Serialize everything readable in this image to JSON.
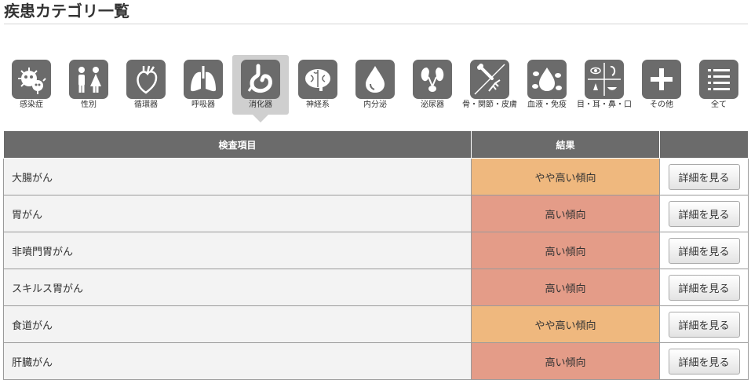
{
  "page": {
    "title": "疾患カテゴリ一覧"
  },
  "categories": [
    {
      "label": "感染症",
      "icon": "virus-icon"
    },
    {
      "label": "性別",
      "icon": "gender-icon"
    },
    {
      "label": "循環器",
      "icon": "heart-icon"
    },
    {
      "label": "呼吸器",
      "icon": "lungs-icon"
    },
    {
      "label": "消化器",
      "icon": "stomach-icon"
    },
    {
      "label": "神経系",
      "icon": "brain-icon"
    },
    {
      "label": "内分泌",
      "icon": "drop-icon"
    },
    {
      "label": "泌尿器",
      "icon": "kidney-icon"
    },
    {
      "label": "骨・関節・皮膚",
      "icon": "bone-icon"
    },
    {
      "label": "血液・免疫",
      "icon": "blood-icon"
    },
    {
      "label": "目・耳・鼻・口",
      "icon": "senses-icon"
    },
    {
      "label": "その他",
      "icon": "plus-icon"
    },
    {
      "label": "全て",
      "icon": "list-icon"
    }
  ],
  "active_category": "消化器",
  "table": {
    "headers": {
      "item": "検査項目",
      "result": "結果",
      "action": ""
    },
    "button_label": "詳細を見る",
    "rows": [
      {
        "item": "大腸がん",
        "result": "やや高い傾向",
        "level": "mid"
      },
      {
        "item": "胃がん",
        "result": "高い傾向",
        "level": "high"
      },
      {
        "item": "非噴門胃がん",
        "result": "高い傾向",
        "level": "high"
      },
      {
        "item": "スキルス胃がん",
        "result": "高い傾向",
        "level": "high"
      },
      {
        "item": "食道がん",
        "result": "やや高い傾向",
        "level": "mid"
      },
      {
        "item": "肝臓がん",
        "result": "高い傾向",
        "level": "high"
      }
    ]
  },
  "colors": {
    "mid": "#efb87e",
    "high": "#e49c88",
    "header": "#6b6b6b",
    "tile": "#6b6b6b"
  }
}
